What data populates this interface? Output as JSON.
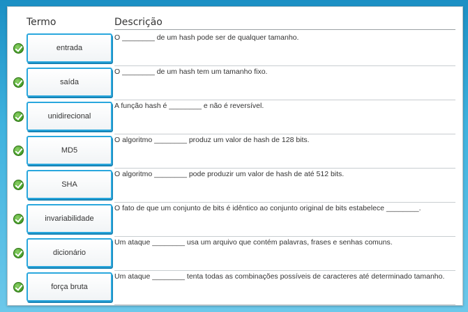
{
  "headers": {
    "term": "Termo",
    "description": "Descrição"
  },
  "rows": [
    {
      "term": "entrada",
      "description": "O ________ de um hash pode ser de qualquer tamanho.",
      "status": "correct"
    },
    {
      "term": "saída",
      "description": "O ________ de um hash tem um tamanho fixo.",
      "status": "correct"
    },
    {
      "term": "unidirecional",
      "description": "A função hash é ________ e não é reversível.",
      "status": "correct"
    },
    {
      "term": "MD5",
      "description": "O algoritmo ________ produz um valor de hash de 128 bits.",
      "status": "correct"
    },
    {
      "term": "SHA",
      "description": "O algoritmo ________ pode produzir um valor de hash de até 512 bits.",
      "status": "correct"
    },
    {
      "term": "invariabilidade",
      "description": "O fato de que um conjunto de bits é idêntico ao conjunto original de bits estabelece ________.",
      "status": "correct"
    },
    {
      "term": "dicionário",
      "description": "Um ataque ________ usa um arquivo que contém palavras, frases e senhas comuns.",
      "status": "correct"
    },
    {
      "term": "força bruta",
      "description": "Um ataque ________ tenta todas as combinações possíveis de caracteres até determinado tamanho.",
      "status": "correct"
    }
  ],
  "colors": {
    "accent": "#29a7dd",
    "check": "#4ea62e"
  },
  "icons": {
    "status": "check-circle-icon"
  }
}
